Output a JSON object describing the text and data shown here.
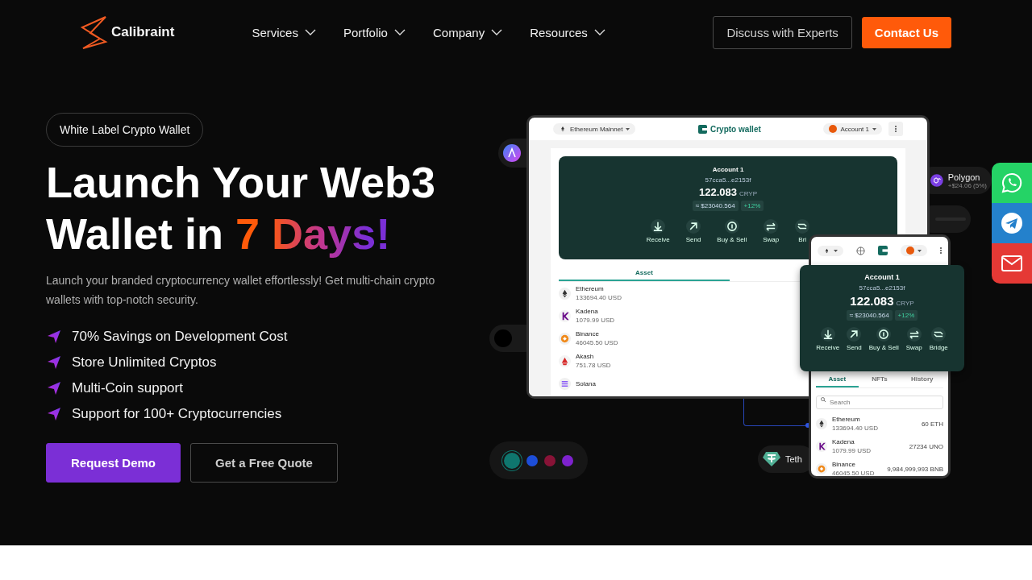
{
  "header": {
    "logo": "Calibraint",
    "nav": [
      {
        "label": "Services"
      },
      {
        "label": "Portfolio"
      },
      {
        "label": "Company"
      },
      {
        "label": "Resources"
      }
    ],
    "buttons": [
      {
        "label": "Discuss with Experts",
        "kind": "outline"
      },
      {
        "label": "Contact Us",
        "kind": "primary"
      }
    ]
  },
  "hero": {
    "badge": "White Label Crypto Wallet",
    "headline": "Launch Your Web3 Wallet in",
    "highlight": "7 Days!",
    "subtitle": "Launch your branded cryptocurrency wallet effortlessly! Get multi-chain crypto wallets with top-notch security.",
    "features": [
      "70% Savings on Development Cost",
      "Store Unlimited Cryptos",
      "Multi-Coin support",
      "Support for 100+ Cryptocurrencies"
    ],
    "buttons": [
      {
        "label": "Request Demo",
        "kind": "primary"
      },
      {
        "label": "Get a Free Quote",
        "kind": "outline"
      }
    ]
  },
  "wallet_desktop": {
    "network": "Ethereum Mainnet",
    "brand": "Crypto wallet",
    "account": "Account 1",
    "card": {
      "account": "Account 1",
      "address": "57cca5...e2153f",
      "balance": "122.083",
      "unit": "CRYP",
      "fiat": "≈ $23040.564",
      "change": "+12%"
    },
    "actions": [
      {
        "kind": "receive",
        "label": "Receive"
      },
      {
        "kind": "send",
        "label": "Send"
      },
      {
        "kind": "buy",
        "label": "Buy & Sell"
      },
      {
        "kind": "swap",
        "label": "Swap"
      },
      {
        "kind": "bridge",
        "label": "Bri"
      }
    ],
    "tabs": [
      {
        "label": "Asset",
        "selected": true
      }
    ],
    "assets": [
      {
        "kind": "ethereum",
        "name": "Ethereum",
        "usd": "133694.40 USD"
      },
      {
        "kind": "kadena",
        "name": "Kadena",
        "usd": "1079.99 USD"
      },
      {
        "kind": "binance",
        "name": "Binance",
        "usd": "46045.50 USD"
      },
      {
        "kind": "akash",
        "name": "Akash",
        "usd": "751.78 USD"
      },
      {
        "kind": "solana",
        "name": "Solana"
      }
    ]
  },
  "wallet_mobile": {
    "card": {
      "account": "Account 1",
      "address": "57cca5...e2153f",
      "balance": "122.083",
      "unit": "CRYP",
      "fiat": "≈ $23040.564",
      "change": "+12%"
    },
    "actions": [
      {
        "kind": "receive",
        "label": "Receive"
      },
      {
        "kind": "send",
        "label": "Send"
      },
      {
        "kind": "buy",
        "label": "Buy & Sell"
      },
      {
        "kind": "swap",
        "label": "Swap"
      },
      {
        "kind": "bridge",
        "label": "Bridge"
      }
    ],
    "tabs": [
      {
        "label": "Asset",
        "selected": true
      },
      {
        "label": "NFTs",
        "selected": false
      },
      {
        "label": "History",
        "selected": false
      }
    ],
    "search": {
      "placeholder": "Search"
    },
    "assets": [
      {
        "kind": "ethereum",
        "name": "Ethereum",
        "usd": "133694.40 USD",
        "amount": "60 ETH"
      },
      {
        "kind": "kadena",
        "name": "Kadena",
        "usd": "1079.99 USD",
        "amount": "27234 UNO"
      },
      {
        "kind": "binance",
        "name": "Binance",
        "usd": "46045.50 USD",
        "amount": "9,984,999,993 BNB"
      }
    ]
  },
  "token_chips": [
    {
      "kind": "polygon",
      "name": "Polygon",
      "change": "+$24.06 (5%)"
    },
    {
      "kind": "tether",
      "name": "Teth"
    }
  ],
  "color_dots": [
    {
      "color": "#0f766e",
      "selected": true
    },
    {
      "color": "#1d4ed8",
      "selected": false
    },
    {
      "color": "#881337",
      "selected": false
    },
    {
      "color": "#7e22ce",
      "selected": false
    }
  ],
  "social": [
    {
      "kind": "whatsapp"
    },
    {
      "kind": "telegram"
    },
    {
      "kind": "email"
    }
  ]
}
